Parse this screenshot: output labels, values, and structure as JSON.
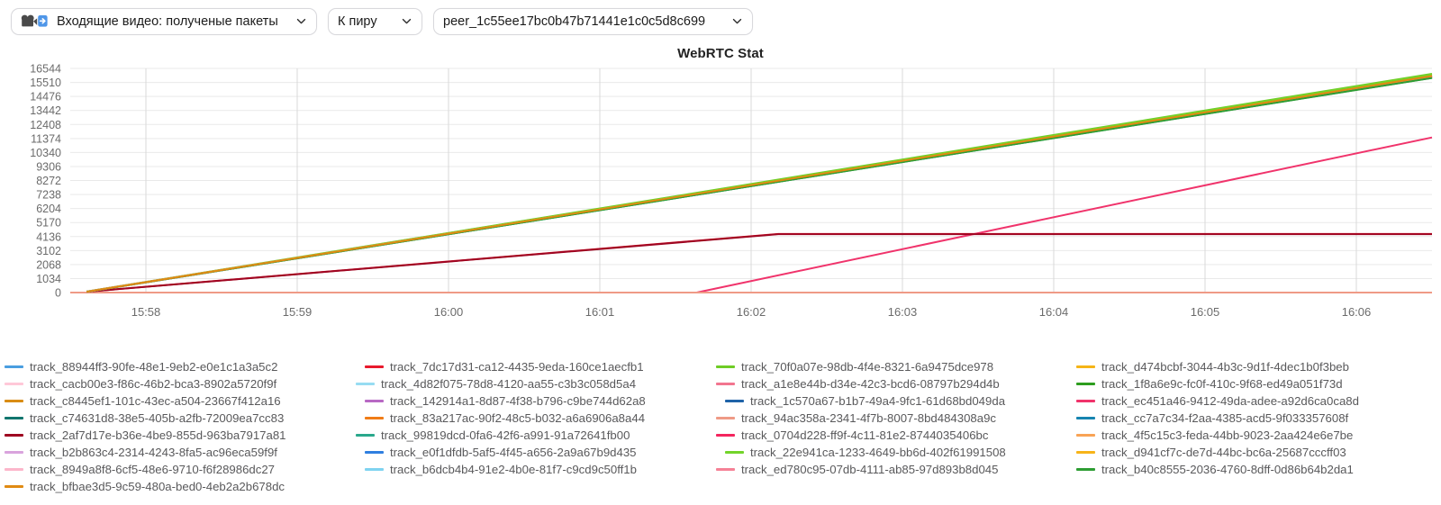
{
  "toolbar": {
    "stat_select": {
      "label": "Входящие видео: полученые пакеты",
      "icon": "incoming-video-icon",
      "chevron": "chevron-down-icon"
    },
    "target_select": {
      "label": "К пиру",
      "chevron": "chevron-down-icon"
    },
    "peer_select": {
      "label": "peer_1c55ee17bc0b47b71441e1c0c5d8c699",
      "chevron": "chevron-down-icon"
    }
  },
  "chart_data": {
    "type": "line",
    "title": "WebRTC Stat",
    "xlabel": "",
    "ylabel": "",
    "grid": true,
    "legend_position": "bottom",
    "ylim": [
      0,
      16544
    ],
    "ytick_labels": [
      "16544",
      "15510",
      "14476",
      "13442",
      "12408",
      "11374",
      "10340",
      "9306",
      "8272",
      "7238",
      "6204",
      "5170",
      "4136",
      "3102",
      "2068",
      "1034",
      "0"
    ],
    "ytick_values": [
      16544,
      15510,
      14476,
      13442,
      12408,
      11374,
      10340,
      9306,
      8272,
      7238,
      6204,
      5170,
      4136,
      3102,
      2068,
      1034,
      0
    ],
    "xtick_labels": [
      "15:58",
      "15:59",
      "16:00",
      "16:01",
      "16:02",
      "16:03",
      "16:04",
      "16:05",
      "16:06"
    ],
    "x_range": [
      "15:57:40",
      "16:06:40"
    ],
    "series": [
      {
        "name": "track_88944ff3-90fe-48e1-9eb2-e0e1c1a3a5c2",
        "color": "#4a9ee0",
        "shape": "flat-zero-short",
        "x": [
          0,
          0.09
        ],
        "values": [
          0,
          0
        ]
      },
      {
        "name": "track_7dc17d31-ca12-4435-9eda-160ce1aecfb1",
        "color": "#e8192c",
        "shape": "rise-then-flat",
        "x": [
          0.012,
          0.52,
          1.0
        ],
        "values": [
          60,
          4330,
          4330
        ]
      },
      {
        "name": "track_70f0a07e-98db-4f4e-8321-6a9475dce978",
        "color": "#6ecc25",
        "shape": "rising",
        "x": [
          0.012,
          1.0
        ],
        "values": [
          80,
          16150
        ]
      },
      {
        "name": "track_d474bcbf-3044-4b3c-9d1f-4dec1b0f3beb",
        "color": "#f5b417",
        "shape": "flat-zero-short",
        "x": [
          0.09,
          0.18
        ],
        "values": [
          0,
          0
        ]
      },
      {
        "name": "track_cacb00e3-f86c-46b2-bca3-8902a5720f9f",
        "color": "#ffc8d8",
        "shape": "flat-zero-short",
        "x": [
          0.18,
          0.245
        ],
        "values": [
          0,
          0
        ]
      },
      {
        "name": "track_4d82f075-78d8-4120-aa55-c3b3c058d5a4",
        "color": "#97dcf2",
        "shape": "rising",
        "x": [
          0.012,
          1.0
        ],
        "values": [
          70,
          15900
        ]
      },
      {
        "name": "track_a1e8e44b-d34e-42c3-bcd6-08797b294d4b",
        "color": "#f2758f",
        "shape": "rising",
        "x": [
          0.012,
          1.0
        ],
        "values": [
          75,
          16050
        ]
      },
      {
        "name": "track_1f8a6e9c-fc0f-410c-9f68-ed49a051f73d",
        "color": "#2d9d1f",
        "shape": "rising",
        "x": [
          0.012,
          1.0
        ],
        "values": [
          55,
          15850
        ]
      },
      {
        "name": "track_c8445ef1-101c-43ec-a504-23667f412a16",
        "color": "#d98c14",
        "shape": "rising",
        "x": [
          0.012,
          1.0
        ],
        "values": [
          65,
          15950
        ]
      },
      {
        "name": "track_142914a1-8d87-4f38-b796-c9be744d62a8",
        "color": "#b869c4",
        "shape": "rising",
        "x": [
          0.012,
          1.0
        ],
        "values": [
          60,
          15980
        ]
      },
      {
        "name": "track_1c570a67-b1b7-49a4-9fc1-61d68bd049da",
        "color": "#1f63a8",
        "shape": "rising",
        "x": [
          0.012,
          1.0
        ],
        "values": [
          58,
          15870
        ]
      },
      {
        "name": "track_ec451a46-9412-49da-adee-a92d6ca0ca8d",
        "color": "#f0336b",
        "shape": "late-rising",
        "x": [
          0.46,
          1.0
        ],
        "values": [
          0,
          11450
        ]
      },
      {
        "name": "track_c74631d8-38e5-405b-a2fb-72009ea7cc83",
        "color": "#11756e",
        "shape": "rising",
        "x": [
          0.012,
          1.0
        ],
        "values": [
          62,
          15920
        ]
      },
      {
        "name": "track_83a217ac-90f2-48c5-b032-a6a6906a8a44",
        "color": "#f07c17",
        "shape": "rising",
        "x": [
          0.012,
          1.0
        ],
        "values": [
          66,
          16000
        ]
      },
      {
        "name": "track_94ac358a-2341-4f7b-8007-8bd484308a9c",
        "color": "#ef9a86",
        "shape": "flat-zero-long",
        "x": [
          0.0,
          1.0
        ],
        "values": [
          0,
          0
        ]
      },
      {
        "name": "track_cc7a7c34-f2aa-4385-acd5-9f033357608f",
        "color": "#1684b0",
        "shape": "rising",
        "x": [
          0.012,
          1.0
        ],
        "values": [
          61,
          15930
        ]
      },
      {
        "name": "track_2af7d17e-b36e-4be9-855d-963ba7917a81",
        "color": "#9e0521",
        "shape": "rise-then-flat",
        "x": [
          0.012,
          0.52,
          1.0
        ],
        "values": [
          60,
          4310,
          4310
        ]
      },
      {
        "name": "track_99819dcd-0fa6-42f6-a991-91a72641fb00",
        "color": "#2aa88c",
        "shape": "rising",
        "x": [
          0.012,
          1.0
        ],
        "values": [
          64,
          15960
        ]
      },
      {
        "name": "track_4f5c15c3-feda-44bb-9023-2aa424e6e7be",
        "color": "#f8a355",
        "shape": "rising",
        "x": [
          0.012,
          1.0
        ],
        "values": [
          59,
          15890
        ]
      },
      {
        "name": "track_b2b863c4-2314-4243-8fa5-ac96eca59f9f",
        "color": "#d9a3dd",
        "shape": "rising",
        "x": [
          0.012,
          1.0
        ],
        "values": [
          63,
          15910
        ]
      },
      {
        "name": "track_e0f1dfdb-5af5-4f45-a656-2a9a67b9d435",
        "color": "#2f7fe0",
        "shape": "rising",
        "x": [
          0.012,
          1.0
        ],
        "values": [
          57,
          15860
        ]
      },
      {
        "name": "track_0704d228-ff9f-4c11-81e2-8744035406bc",
        "color": "#f4255e",
        "shape": "rising",
        "x": [
          0.012,
          1.0
        ],
        "values": [
          62,
          16020
        ]
      },
      {
        "name": "track_22e941ca-1233-4649-bb6d-402f61991508",
        "color": "#72d42a",
        "shape": "rising",
        "x": [
          0.012,
          1.0
        ],
        "values": [
          68,
          16100
        ]
      },
      {
        "name": "track_d941cf7c-de7d-44bc-bc6a-25687cccff03",
        "color": "#f7b419",
        "shape": "rising",
        "x": [
          0.012,
          1.0
        ],
        "values": [
          60,
          15940
        ]
      },
      {
        "name": "track_8949a8f8-6cf5-48e6-9710-f6f28986dc27",
        "color": "#fcb6cb",
        "shape": "rising",
        "x": [
          0.012,
          1.0
        ],
        "values": [
          61,
          15970
        ]
      },
      {
        "name": "track_b6dcb4b4-91e2-4b0e-81f7-c9cd9c50ff1b",
        "color": "#7fd3f0",
        "shape": "rising",
        "x": [
          0.012,
          1.0
        ],
        "values": [
          58,
          15880
        ]
      },
      {
        "name": "track_ed780c95-07db-4111-ab85-97d893b8d045",
        "color": "#f58196",
        "shape": "rising",
        "x": [
          0.012,
          1.0
        ],
        "values": [
          60,
          15900
        ]
      },
      {
        "name": "track_b40c8555-2036-4760-8dff-0d86b64b2da1",
        "color": "#2d9d33",
        "shape": "rising",
        "x": [
          0.012,
          1.0
        ],
        "values": [
          56,
          15840
        ]
      },
      {
        "name": "track_bfbae3d5-9c59-480a-bed0-4eb2a2b678dc",
        "color": "#e08a12",
        "shape": "rising",
        "x": [
          0.012,
          1.0
        ],
        "values": [
          63,
          15990
        ]
      }
    ],
    "legend_entries": [
      {
        "label": "track_88944ff3-90fe-48e1-9eb2-e0e1c1a3a5c2",
        "color": "#4a9ee0"
      },
      {
        "label": "track_7dc17d31-ca12-4435-9eda-160ce1aecfb1",
        "color": "#e8192c"
      },
      {
        "label": "track_70f0a07e-98db-4f4e-8321-6a9475dce978",
        "color": "#6ecc25"
      },
      {
        "label": "track_d474bcbf-3044-4b3c-9d1f-4dec1b0f3beb",
        "color": "#f5b417"
      },
      {
        "label": "track_cacb00e3-f86c-46b2-bca3-8902a5720f9f",
        "color": "#ffc8d8"
      },
      {
        "label": "track_4d82f075-78d8-4120-aa55-c3b3c058d5a4",
        "color": "#97dcf2"
      },
      {
        "label": "track_a1e8e44b-d34e-42c3-bcd6-08797b294d4b",
        "color": "#f2758f"
      },
      {
        "label": "track_1f8a6e9c-fc0f-410c-9f68-ed49a051f73d",
        "color": "#2d9d1f"
      },
      {
        "label": "track_c8445ef1-101c-43ec-a504-23667f412a16",
        "color": "#d98c14"
      },
      {
        "label": "track_142914a1-8d87-4f38-b796-c9be744d62a8",
        "color": "#b869c4"
      },
      {
        "label": "track_1c570a67-b1b7-49a4-9fc1-61d68bd049da",
        "color": "#1f63a8"
      },
      {
        "label": "track_ec451a46-9412-49da-adee-a92d6ca0ca8d",
        "color": "#f0336b"
      },
      {
        "label": "track_c74631d8-38e5-405b-a2fb-72009ea7cc83",
        "color": "#11756e"
      },
      {
        "label": "track_83a217ac-90f2-48c5-b032-a6a6906a8a44",
        "color": "#f07c17"
      },
      {
        "label": "track_94ac358a-2341-4f7b-8007-8bd484308a9c",
        "color": "#ef9a86"
      },
      {
        "label": "track_cc7a7c34-f2aa-4385-acd5-9f033357608f",
        "color": "#1684b0"
      },
      {
        "label": "track_2af7d17e-b36e-4be9-855d-963ba7917a81",
        "color": "#9e0521"
      },
      {
        "label": "track_99819dcd-0fa6-42f6-a991-91a72641fb00",
        "color": "#2aa88c"
      },
      {
        "label": "track_0704d228-ff9f-4c11-81e2-8744035406bc",
        "color": "#f4255e"
      },
      {
        "label": "track_4f5c15c3-feda-44bb-9023-2aa424e6e7be",
        "color": "#f8a355"
      },
      {
        "label": "track_b2b863c4-2314-4243-8fa5-ac96eca59f9f",
        "color": "#d9a3dd"
      },
      {
        "label": "track_e0f1dfdb-5af5-4f45-a656-2a9a67b9d435",
        "color": "#2f7fe0"
      },
      {
        "label": "track_22e941ca-1233-4649-bb6d-402f61991508",
        "color": "#72d42a"
      },
      {
        "label": "track_d941cf7c-de7d-44bc-bc6a-25687cccff03",
        "color": "#f7b419"
      },
      {
        "label": "track_8949a8f8-6cf5-48e6-9710-f6f28986dc27",
        "color": "#fcb6cb"
      },
      {
        "label": "track_b6dcb4b4-91e2-4b0e-81f7-c9cd9c50ff1b",
        "color": "#7fd3f0"
      },
      {
        "label": "track_ed780c95-07db-4111-ab85-97d893b8d045",
        "color": "#f58196"
      },
      {
        "label": "track_b40c8555-2036-4760-8dff-0d86b64b2da1",
        "color": "#2d9d33"
      },
      {
        "label": "track_bfbae3d5-9c59-480a-bed0-4eb2a2b678dc",
        "color": "#e08a12"
      }
    ]
  }
}
